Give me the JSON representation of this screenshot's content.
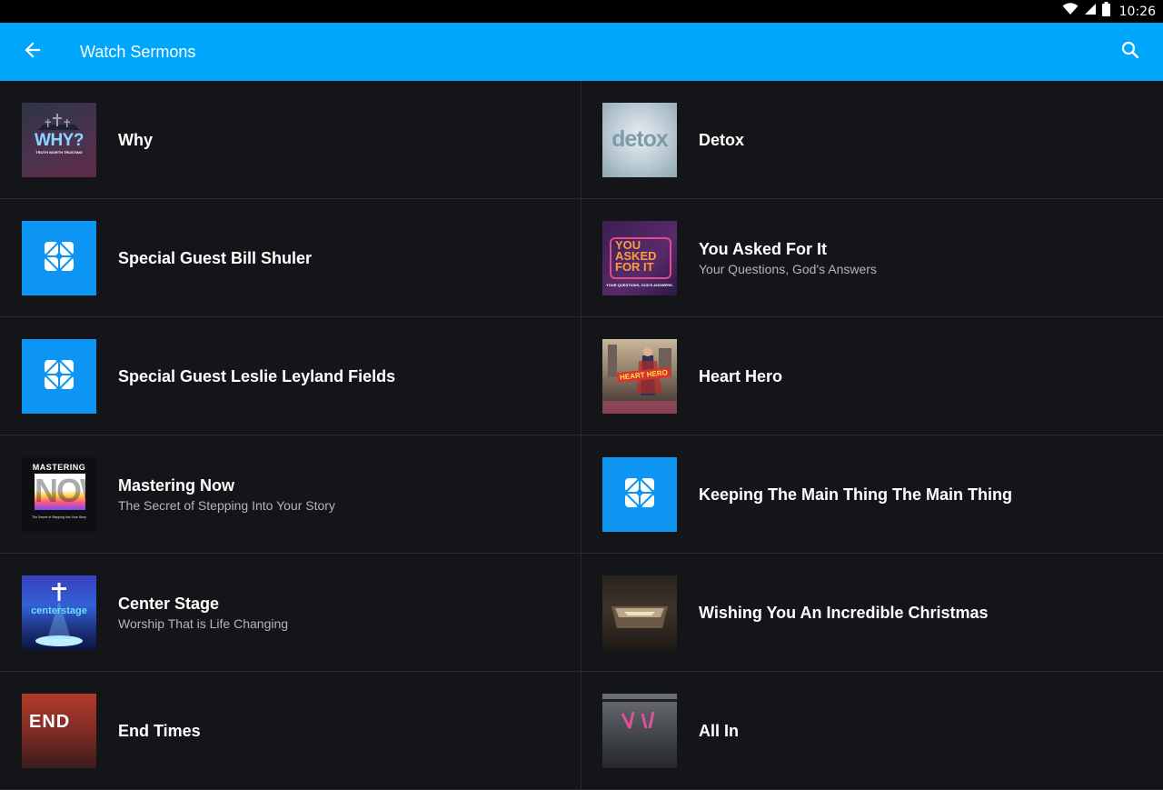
{
  "status": {
    "time": "10:26"
  },
  "appbar": {
    "title": "Watch Sermons"
  },
  "sermons": [
    {
      "title": "Why",
      "subtitle": "",
      "thumb_text": "WHY?",
      "thumb_sub": "TRUTH WORTH TRUSTING"
    },
    {
      "title": "Detox",
      "subtitle": "",
      "thumb_text": "detox"
    },
    {
      "title": "Special Guest Bill Shuler",
      "subtitle": ""
    },
    {
      "title": "You Asked For It",
      "subtitle": "Your Questions, God's Answers",
      "thumb_text": "YOU ASKED FOR IT",
      "thumb_sub": "YOUR QUESTIONS, GOD'S ANSWERS."
    },
    {
      "title": "Special Guest Leslie Leyland Fields",
      "subtitle": ""
    },
    {
      "title": "Heart Hero",
      "subtitle": "",
      "thumb_text": "HEART HERO"
    },
    {
      "title": "Mastering Now",
      "subtitle": "The Secret of Stepping Into Your Story",
      "thumb_text": "MASTERING",
      "thumb_text2": "NOW"
    },
    {
      "title": "Keeping The Main Thing The Main Thing",
      "subtitle": ""
    },
    {
      "title": "Center Stage",
      "subtitle": "Worship That is Life Changing",
      "thumb_text": "centerstage"
    },
    {
      "title": "Wishing You An Incredible Christmas",
      "subtitle": ""
    },
    {
      "title": "End Times",
      "subtitle": "",
      "thumb_text": "END"
    },
    {
      "title": "All In",
      "subtitle": ""
    }
  ],
  "icons": {
    "back": "arrow-back-icon",
    "search": "search-icon",
    "placeholder": "church-logo-icon"
  },
  "colors": {
    "appbar": "#00a6fb",
    "placeholder": "#0c95f2",
    "background": "#141518"
  }
}
